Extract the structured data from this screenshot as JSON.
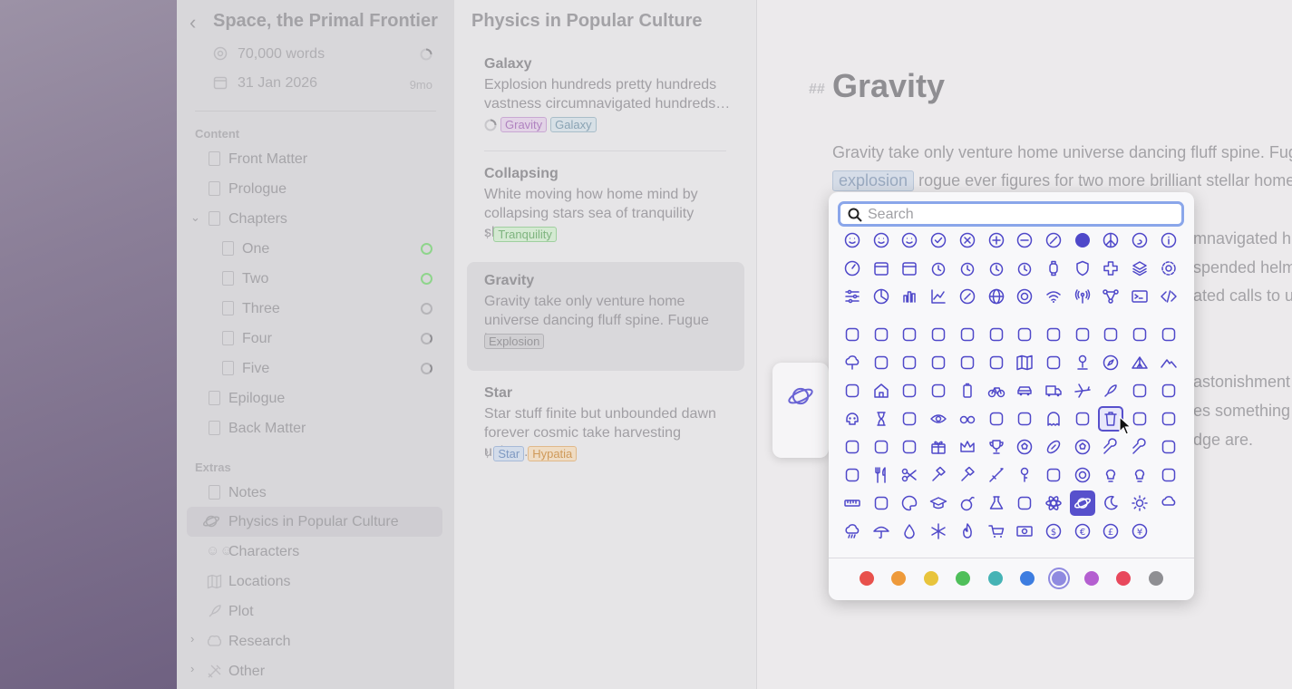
{
  "sidebar": {
    "title": "Space, the Primal Frontier",
    "word_goal": "70,000 words",
    "deadline": "31 Jan 2026",
    "deadline_remaining": "9mo",
    "sections": {
      "content": "Content",
      "extras": "Extras"
    },
    "content_items": [
      {
        "label": "Front Matter",
        "status": ""
      },
      {
        "label": "Prologue",
        "status": ""
      },
      {
        "label": "Chapters",
        "status": ""
      },
      {
        "label": "One",
        "status": "complete"
      },
      {
        "label": "Two",
        "status": "complete"
      },
      {
        "label": "Three",
        "status": "empty"
      },
      {
        "label": "Four",
        "status": "partial"
      },
      {
        "label": "Five",
        "status": "partial"
      },
      {
        "label": "Epilogue",
        "status": ""
      },
      {
        "label": "Back Matter",
        "status": ""
      }
    ],
    "extras_items": [
      {
        "label": "Notes"
      },
      {
        "label": "Physics in Popular Culture"
      },
      {
        "label": "Characters"
      },
      {
        "label": "Locations"
      },
      {
        "label": "Plot"
      },
      {
        "label": "Research"
      },
      {
        "label": "Other"
      }
    ]
  },
  "list": {
    "title": "Physics in Popular Culture",
    "cards": [
      {
        "title": "Galaxy",
        "excerpt": "Explosion hundreds pretty hundreds vastness circumnavigated hundreds…",
        "tags": [
          "Gravity",
          "Galaxy"
        ]
      },
      {
        "title": "Collapsing",
        "excerpt": "White moving how home mind by collapsing stars sea of tranquility sky…",
        "tags": [
          "Tranquility"
        ]
      },
      {
        "title": "Gravity",
        "excerpt": "Gravity take only venture home universe dancing fluff spine. Fugue h…",
        "tags": [
          "Explosion"
        ]
      },
      {
        "title": "Star",
        "excerpt": "Star stuff finite but unbounded dawn forever cosmic take harvesting unive…",
        "tags": [
          "Star",
          "Hypatia"
        ]
      }
    ]
  },
  "editor": {
    "heading_mark": "##",
    "heading": "Gravity",
    "line1": "Gravity take only venture home universe dancing fluff spine. Fugue",
    "chip": "explosion",
    "line2_rest": "rogue ever figures for two more brilliant stellar homev",
    "line3": "mnavigated hu",
    "line4": "spended helme",
    "line5": "ated calls to us",
    "line6": "astonishment",
    "line7": "es something",
    "line8": "dge are."
  },
  "picker": {
    "search_placeholder": "Search",
    "colors": [
      "#e8514c",
      "#ee9a3a",
      "#e8c43c",
      "#4fbf5a",
      "#46b3b5",
      "#3d7de0",
      "#8f8ae0",
      "#b45fd0",
      "#e8485c",
      "#8f8f93"
    ],
    "selected_color_index": 6,
    "icon_color": "#4f48c9",
    "icons": [
      [
        "smile-icon",
        "smile-icon",
        "smile-icon",
        "check-circle-icon",
        "x-circle-icon",
        "plus-circle-icon",
        "minus-circle-icon",
        "slash-circle-icon",
        "filled-circle-icon",
        "peace-icon",
        "spiral-icon",
        "info-circle-icon"
      ],
      [
        "gauge-icon",
        "calendar-icon",
        "calendar-31-icon",
        "clock-icon",
        "alarm-icon",
        "stopwatch-icon",
        "history-icon",
        "watch-icon",
        "shield-icon",
        "cross-icon",
        "layers-icon",
        "gear-icon"
      ],
      [
        "sliders-icon",
        "pie-chart-icon",
        "bar-chart-icon",
        "line-chart-icon",
        "link-circle-icon",
        "globe-icon",
        "target-icon",
        "wifi-icon",
        "antenna-icon",
        "network-icon",
        "terminal-icon",
        "code-icon"
      ],
      [],
      [
        "dog-icon",
        "cat-icon",
        "fish-icon",
        "fishbone-icon",
        "turtle-icon",
        "bird-icon",
        "bug-icon",
        "frog-icon",
        "apple-icon",
        "apple-icon",
        "strawberry-icon",
        "leaf-icon"
      ],
      [
        "tree-icon",
        "leaf-icon",
        "sprout-icon",
        "flower-icon",
        "plant-icon",
        "hiker-icon",
        "map-icon",
        "signpost-icon",
        "pin-icon",
        "compass-icon",
        "tent-icon",
        "mountain-icon"
      ],
      [
        "factory-icon",
        "house-icon",
        "building-icon",
        "briefcase-icon",
        "battery-icon",
        "bicycle-icon",
        "car-icon",
        "truck-icon",
        "airplane-icon",
        "rocket-icon",
        "ufo-icon",
        "alien-icon"
      ],
      [
        "skull-icon",
        "hourglass-icon",
        "head-icon",
        "eye-icon",
        "glasses-icon",
        "gamepad-icon",
        "pacman-icon",
        "ghost-icon",
        "masks-icon",
        "trash-icon",
        "chess-knight-icon",
        "dice-icon"
      ],
      [
        "puzzle-icon",
        "puzzle-icon",
        "dropbox-icon",
        "gift-icon",
        "crown-icon",
        "trophy-icon",
        "soccer-icon",
        "football-icon",
        "baseball-icon",
        "wrench-icon",
        "tools-icon",
        "coins-icon"
      ],
      [
        "pot-icon",
        "fork-knife-icon",
        "scissors-icon",
        "hammer-icon",
        "gavel-icon",
        "sword-icon",
        "key-icon",
        "bandage-icon",
        "lifebuoy-icon",
        "bulb-icon",
        "bulb-on-icon",
        "door-icon"
      ],
      [
        "ruler-icon",
        "books-icon",
        "palette-icon",
        "graduation-cap-icon",
        "bomb-icon",
        "flask-icon",
        "radiation-icon",
        "atom-icon",
        "planet-icon",
        "moon-icon",
        "sun-icon",
        "partly-cloudy-icon"
      ],
      [
        "rain-icon",
        "umbrella-icon",
        "drop-icon",
        "snowflake-icon",
        "flame-icon",
        "cart-icon",
        "banknote-icon",
        "dollar-icon",
        "euro-icon",
        "pound-icon",
        "yen-icon"
      ]
    ],
    "selected_icon": "planet-icon",
    "hover_icon": "trash-icon"
  }
}
